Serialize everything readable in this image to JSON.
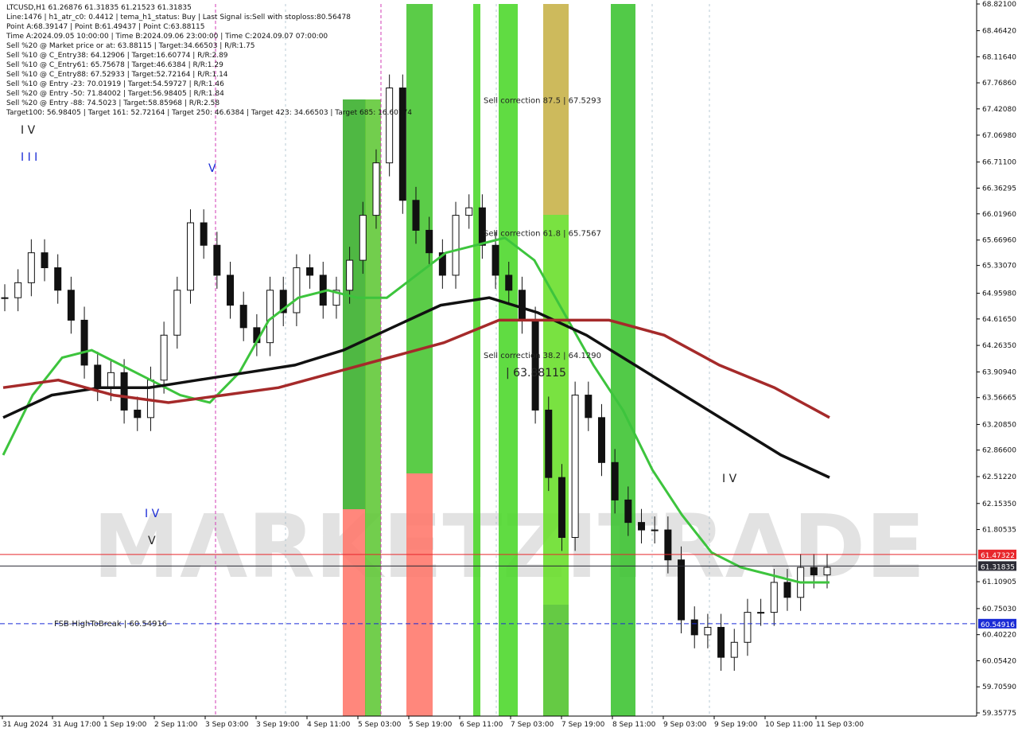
{
  "chart_data": {
    "type": "candlestick",
    "symbol": "LTCUSD,H1",
    "ohlc_header": "LTCUSD,H1  61.26876 61.31835 61.21523 61.31835",
    "info_lines": [
      "Line:1476 | h1_atr_c0: 0.4412 | tema_h1_status: Buy | Last Signal is:Sell with stoploss:80.56478",
      "Point A:68.39147 | Point B:61.49437 | Point C:63.88115",
      "Time A:2024.09.05 10:00:00 | Time B:2024.09.06 23:00:00 | Time C:2024.09.07 07:00:00",
      "Sell %20 @ Market price or at: 63.88115 | Target:34.66503 | R/R:1.75",
      "Sell %10 @ C_Entry38: 64.12906 | Target:16.60774 | R/R:2.89",
      "Sell %10 @ C_Entry61: 65.75678 | Target:46.6384 | R/R:1.29",
      "Sell %10 @ C_Entry88: 67.52933 | Target:52.72164 | R/R:1.14",
      "Sell %10 @ Entry -23: 70.01919 | Target:54.59727 | R/R:1.46",
      "Sell %20 @ Entry -50: 71.84002 | Target:56.98405 | R/R:1.84",
      "Sell %20 @ Entry -88: 74.5023 | Target:58.85968 | R/R:2.58",
      "Target100: 56.98405 | Target 161: 52.72164 | Target 250: 46.6384 | Target 423: 34.66503 | Target 685: 16.60774"
    ],
    "y_ticks": [
      "68.82100",
      "68.46420",
      "68.11640",
      "67.76860",
      "67.42080",
      "67.06980",
      "66.71100",
      "66.36295",
      "66.01960",
      "65.66960",
      "65.33070",
      "64.95980",
      "64.61650",
      "64.26350",
      "63.90940",
      "63.56665",
      "63.20850",
      "62.86600",
      "62.51220",
      "62.15350",
      "61.80535",
      "61.10905",
      "60.75030",
      "60.40220",
      "60.05420",
      "59.70590",
      "59.35775"
    ],
    "x_ticks": [
      "31 Aug 2024",
      "31 Aug 17:00",
      "1 Sep 19:00",
      "2 Sep 11:00",
      "3 Sep 03:00",
      "3 Sep 19:00",
      "4 Sep 11:00",
      "5 Sep 03:00",
      "5 Sep 19:00",
      "6 Sep 11:00",
      "7 Sep 03:00",
      "7 Sep 19:00",
      "8 Sep 11:00",
      "9 Sep 03:00",
      "9 Sep 19:00",
      "10 Sep 11:00",
      "11 Sep 03:00"
    ],
    "ylim": [
      59.35775,
      68.821
    ],
    "price_tags": [
      {
        "label": "61.47322",
        "value": 61.47322,
        "color": "#e8262b",
        "line": "solid"
      },
      {
        "label": "61.31835",
        "value": 61.31835,
        "color": "#2c2c36",
        "line": "solid"
      },
      {
        "label": "60.54916",
        "value": 60.54916,
        "color": "#1a2bd6",
        "line": "dashed"
      }
    ],
    "annotations": [
      {
        "text": "Sell correction 87.5 | 67.5293",
        "value": 67.5293
      },
      {
        "text": "Sell correction 61.8 | 65.7567",
        "value": 65.7567
      },
      {
        "text": "Sell correction 38.2 | 64.1290",
        "value": 64.129
      },
      {
        "text": "| 63.88115",
        "value": 63.88115
      },
      {
        "text": "FSB-HighToBreak | 60.54916",
        "value": 60.54916
      }
    ],
    "wave_labels": [
      "I V",
      "I I I",
      "V",
      "I V",
      "V",
      "I V"
    ],
    "watermark": "MARKETZITRADE",
    "series": [
      {
        "name": "close",
        "values": [
          64.9,
          65.1,
          65.5,
          65.3,
          65.0,
          64.6,
          64.0,
          63.7,
          63.9,
          63.4,
          63.3,
          63.8,
          64.4,
          65.0,
          65.9,
          65.6,
          65.2,
          64.8,
          64.5,
          64.3,
          65.0,
          64.7,
          65.3,
          65.2,
          64.8,
          65.0,
          65.4,
          66.0,
          66.7,
          67.7,
          66.2,
          65.8,
          65.5,
          65.2,
          66.0,
          66.1,
          65.6,
          65.2,
          65.0,
          64.6,
          63.4,
          62.5,
          61.7,
          63.6,
          63.3,
          62.7,
          62.2,
          61.9,
          61.8,
          61.8,
          61.4,
          60.6,
          60.4,
          60.5,
          60.1,
          60.3,
          60.7,
          60.7,
          61.1,
          60.9,
          61.3,
          61.2,
          61.3
        ]
      },
      {
        "name": "tema-green",
        "color": "#3dc43d",
        "values": [
          62.8,
          63.6,
          64.1,
          64.2,
          64.0,
          63.8,
          63.6,
          63.5,
          63.9,
          64.6,
          64.9,
          65.0,
          64.9,
          64.9,
          65.2,
          65.5,
          65.6,
          65.7,
          65.4,
          64.7,
          64.0,
          63.4,
          62.6,
          62.0,
          61.5,
          61.3,
          61.2,
          61.1,
          61.1
        ]
      },
      {
        "name": "ma-black",
        "color": "#111111",
        "values": [
          63.3,
          63.6,
          63.7,
          63.7,
          63.8,
          63.9,
          64.0,
          64.2,
          64.5,
          64.8,
          64.9,
          64.7,
          64.4,
          64.0,
          63.6,
          63.2,
          62.8,
          62.5
        ]
      },
      {
        "name": "ma-darkred",
        "color": "#a52a2a",
        "values": [
          63.7,
          63.8,
          63.6,
          63.5,
          63.6,
          63.7,
          63.9,
          64.1,
          64.3,
          64.6,
          64.6,
          64.6,
          64.4,
          64.0,
          63.7,
          63.3
        ]
      }
    ]
  }
}
